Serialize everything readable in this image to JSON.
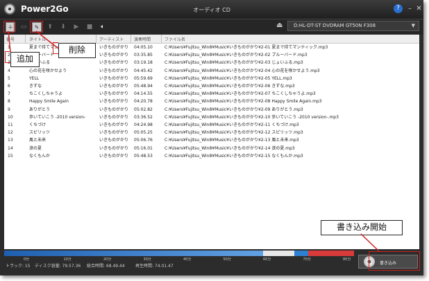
{
  "app": {
    "name": "Power2Go",
    "window_title": "オーディオ CD"
  },
  "titlebar": {
    "help": "?",
    "minimize": "–",
    "close": "✕"
  },
  "toolbar": {
    "icons": [
      "add-file-icon",
      "remove-file-icon",
      "edit-icon",
      "move-up-icon",
      "move-down-icon",
      "play-icon",
      "stop-icon",
      "volume-icon"
    ]
  },
  "drive": {
    "selected": "D:HL-DT-ST DVDRAM GT50N F308"
  },
  "table": {
    "headers": {
      "num": "番号",
      "title": "タイトル",
      "artist": "アーティスト",
      "time": "演奏時間",
      "file": "ファイル名"
    },
    "rows": [
      {
        "num": "1",
        "title": "夏まで待てマンティック",
        "artist": "いきものがかり",
        "time": "04:05.10",
        "file": "C:¥Users¥Fujitsu_Win8¥Music¥いきものがかり¥2-01 夏まで待てマンティック.mp3"
      },
      {
        "num": "2",
        "title": "ブルーバード",
        "artist": "いきものがかり",
        "time": "03:35.85",
        "file": "C:¥Users¥Fujitsu_Win8¥Music¥いきものがかり¥2-02 ブルーバード.mp3"
      },
      {
        "num": "3",
        "title": "じょいふる",
        "artist": "いきものがかり",
        "time": "03:19.18",
        "file": "C:¥Users¥Fujitsu_Win8¥Music¥いきものがかり¥2-03 じょいふる.mp3"
      },
      {
        "num": "4",
        "title": "心の花を咲かせよう",
        "artist": "いきものがかり",
        "time": "04:45.42",
        "file": "C:¥Users¥Fujitsu_Win8¥Music¥いきものがかり¥2-04 心の花を咲かせよう.mp3"
      },
      {
        "num": "5",
        "title": "YELL",
        "artist": "いきものがかり",
        "time": "05:59.69",
        "file": "C:¥Users¥Fujitsu_Win8¥Music¥いきものがかり¥2-05 YELL.mp3"
      },
      {
        "num": "6",
        "title": "きずな",
        "artist": "いきものがかり",
        "time": "05:48.94",
        "file": "C:¥Users¥Fujitsu_Win8¥Music¥いきものがかり¥2-06 きずな.mp3"
      },
      {
        "num": "7",
        "title": "ちこくしちゃうよ",
        "artist": "いきものがかり",
        "time": "04:14.55",
        "file": "C:¥Users¥Fujitsu_Win8¥Music¥いきものがかり¥2-07 ちこくしちゃうよ.mp3"
      },
      {
        "num": "8",
        "title": "Happy Smile Again",
        "artist": "いきものがかり",
        "time": "04:20.78",
        "file": "C:¥Users¥Fujitsu_Win8¥Music¥いきものがかり¥2-08 Happy Smile Again.mp3"
      },
      {
        "num": "9",
        "title": "ありがとう",
        "artist": "いきものがかり",
        "time": "05:02.82",
        "file": "C:¥Users¥Fujitsu_Win8¥Music¥いきものがかり¥2-09 ありがとう.mp3"
      },
      {
        "num": "10",
        "title": "歩いていこう -2010 version-",
        "artist": "いきものがかり",
        "time": "03:36.52",
        "file": "C:¥Users¥Fujitsu_Win8¥Music¥いきものがかり¥2-10 歩いていこう -2010 version-.mp3"
      },
      {
        "num": "11",
        "title": "くちづけ",
        "artist": "いきものがかり",
        "time": "04:24.98",
        "file": "C:¥Users¥Fujitsu_Win8¥Music¥いきものがかり¥2-11 くちづけ.mp3"
      },
      {
        "num": "12",
        "title": "スピリッツ",
        "artist": "いきものがかり",
        "time": "05:05.25",
        "file": "C:¥Users¥Fujitsu_Win8¥Music¥いきものがかり¥2-12 スピリッツ.mp3"
      },
      {
        "num": "13",
        "title": "風と未来",
        "artist": "いきものがかり",
        "time": "05:06.76",
        "file": "C:¥Users¥Fujitsu_Win8¥Music¥いきものがかり¥2-13 風と未来.mp3"
      },
      {
        "num": "14",
        "title": "涙の夏",
        "artist": "いきものがかり",
        "time": "05:16.01",
        "file": "C:¥Users¥Fujitsu_Win8¥Music¥いきものがかり¥2-14 涙の夏.mp3"
      },
      {
        "num": "15",
        "title": "なくもんか",
        "artist": "いきものがかり",
        "time": "05:48.53",
        "file": "C:¥Users¥Fujitsu_Win8¥Music¥いきものがかり¥2-15 なくもんか.mp3"
      }
    ]
  },
  "callouts": {
    "add": "追加",
    "delete": "削除",
    "burn_start": "書き込み開始"
  },
  "capacity": {
    "ticks": [
      "0分",
      "10分",
      "20分",
      "30分",
      "40分",
      "50分",
      "60分",
      "70分",
      "80分"
    ],
    "used_fraction": 0.83,
    "limit_fraction": 0.87
  },
  "status": {
    "tracks": "トラック: 15",
    "disc_capacity": "ディスク容量: 79.57.36",
    "total_time": "総合時間: 68.49.44",
    "play_time": "再生時間: 74.01.47"
  },
  "burn_button": {
    "label": "書き込み"
  },
  "colors": {
    "bar": "#2f7fd0",
    "overflow": "#d93a3a",
    "callout_border": "#d02020"
  }
}
